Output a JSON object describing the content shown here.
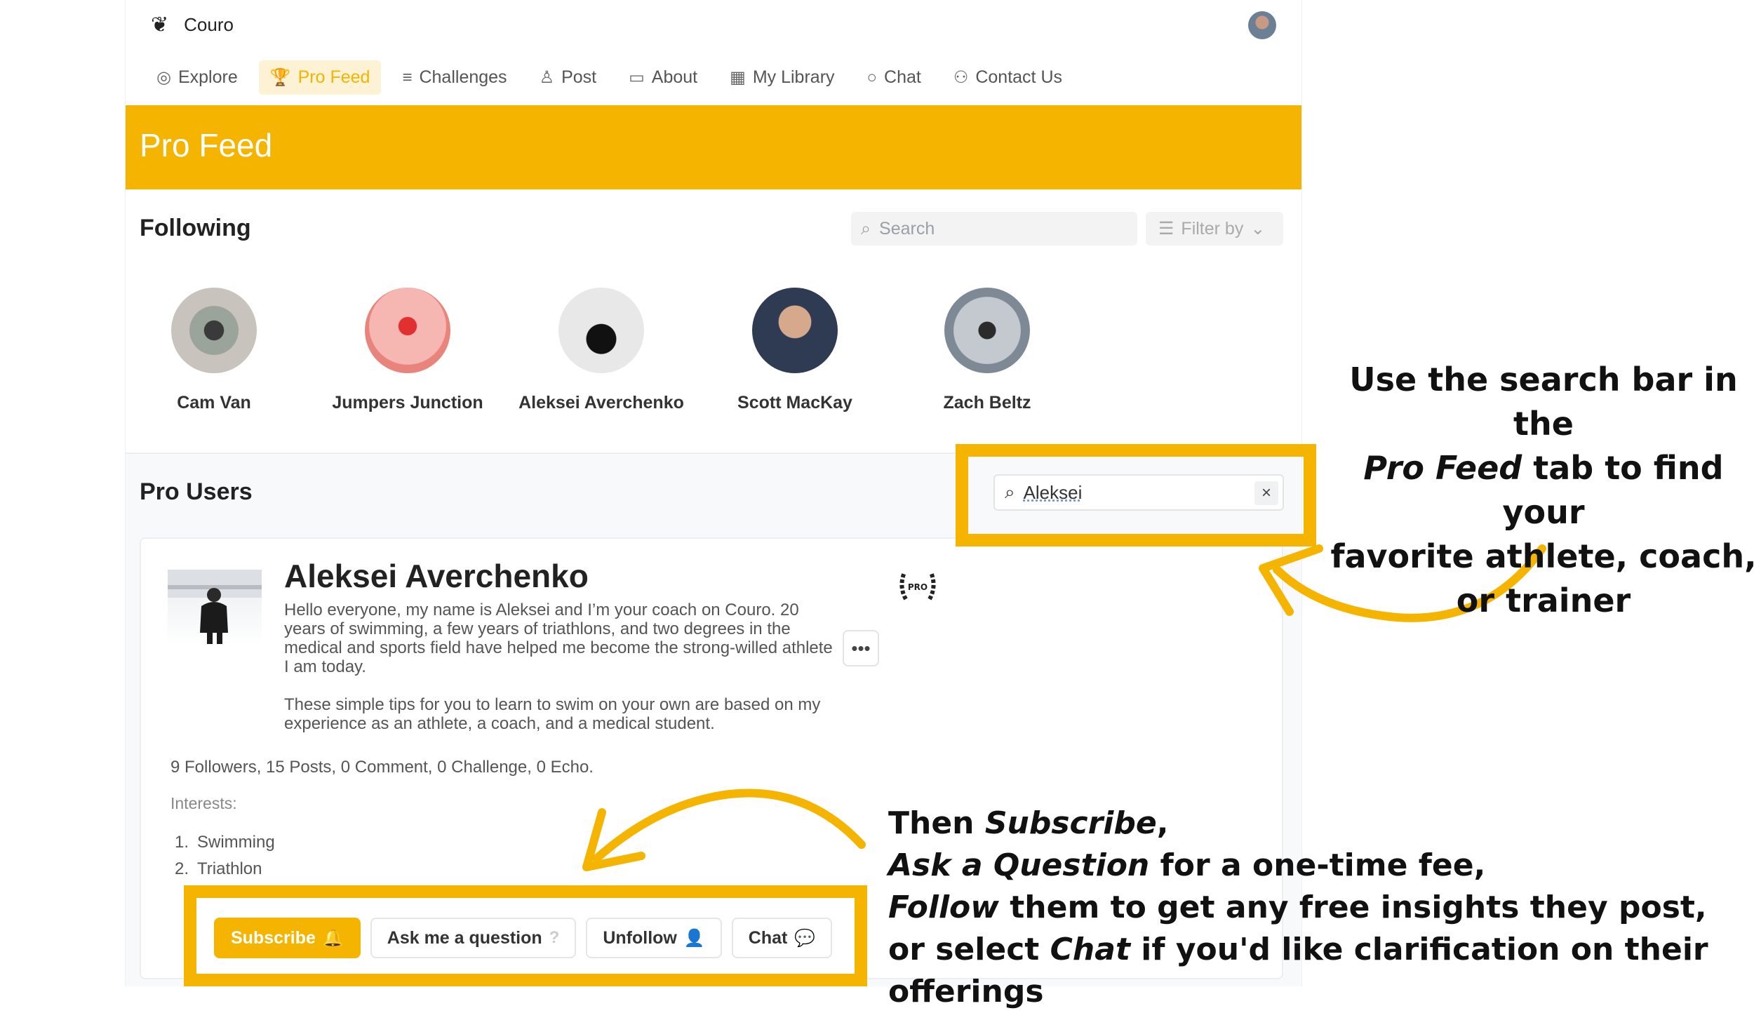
{
  "app": {
    "name": "Couro"
  },
  "nav": {
    "items": [
      {
        "label": "Explore",
        "icon": "compass-icon",
        "active": false
      },
      {
        "label": "Pro Feed",
        "icon": "trophy-icon",
        "active": true
      },
      {
        "label": "Challenges",
        "icon": "list-icon",
        "active": false
      },
      {
        "label": "Post",
        "icon": "user-icon",
        "active": false
      },
      {
        "label": "About",
        "icon": "monitor-icon",
        "active": false
      },
      {
        "label": "My Library",
        "icon": "library-plus-icon",
        "active": false
      },
      {
        "label": "Chat",
        "icon": "chat-bubble-icon",
        "active": false
      },
      {
        "label": "Contact Us",
        "icon": "users-icon",
        "active": false
      }
    ]
  },
  "banner": {
    "title": "Pro Feed"
  },
  "following": {
    "title": "Following",
    "search_placeholder": "Search",
    "filter_label": "Filter by",
    "people": [
      {
        "name": "Cam Van"
      },
      {
        "name": "Jumpers  Junction"
      },
      {
        "name": "Aleksei Averchenko"
      },
      {
        "name": "Scott MacKay"
      },
      {
        "name": "Zach Beltz"
      }
    ]
  },
  "pro_users": {
    "title": "Pro Users",
    "search_value": "Aleksei",
    "card": {
      "name": "Aleksei Averchenko",
      "bio_1": "Hello everyone, my name is Aleksei and I’m your coach on Couro. 20 years of swimming, a few years of triathlons, and two degrees in the medical and sports field have helped me become the strong-willed athlete I am today.",
      "bio_2": "These simple tips for you to learn to swim on your own are based on my experience as an athlete, a coach, and a medical student.",
      "badge": "PRO",
      "stats": "9 Followers,  15 Posts,  0 Comment,  0 Challenge,  0 Echo.",
      "interests_label": "Interests:",
      "interests": [
        {
          "num": "1.",
          "label": "Swimming"
        },
        {
          "num": "2.",
          "label": "Triathlon"
        }
      ],
      "buttons": {
        "subscribe": "Subscribe",
        "ask": "Ask me a question",
        "unfollow": "Unfollow",
        "chat": "Chat"
      }
    }
  },
  "annotations": {
    "search_tip": {
      "line1": "Use the search bar in the",
      "line2_italic": "Pro Feed",
      "line2_rest": " tab to find your",
      "line3": "favorite athlete, coach,",
      "line4": "or trainer"
    },
    "action_tip": {
      "l1_a": "Then ",
      "l1_b": "Subscribe",
      "l1_c": ",",
      "l2_a": "Ask a Question",
      "l2_b": " for a one-time fee,",
      "l3_a": "Follow",
      "l3_b": " them to get any free insights they post,",
      "l4_a": "or select ",
      "l4_b": "Chat",
      "l4_c": " if you'd like clarification on their offerings"
    }
  },
  "colors": {
    "accent": "#f5b400",
    "banner_text": "#ffffff"
  }
}
